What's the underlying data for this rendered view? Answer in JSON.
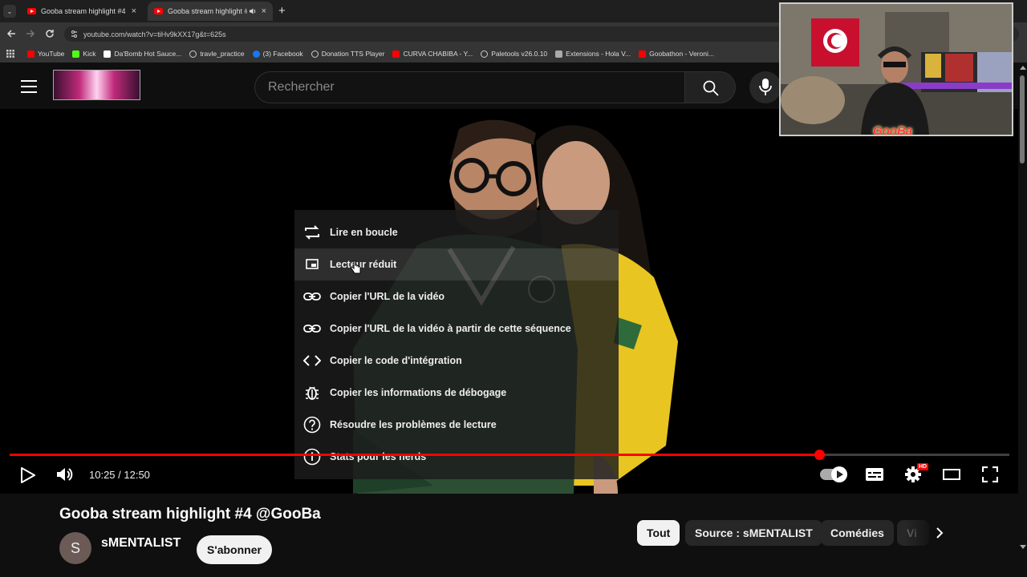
{
  "browser": {
    "tabs": [
      {
        "label": "Gooba stream highlight #4 @G",
        "close": "×"
      },
      {
        "label": "Gooba stream highlight #4",
        "close": "×"
      }
    ],
    "new_tab": "+",
    "url": "youtube.com/watch?v=tiHv9kXX17g&t=625s",
    "bookmarks": [
      {
        "label": "YouTube",
        "color": "#ff0000"
      },
      {
        "label": "Kick",
        "color": "#53fc18"
      },
      {
        "label": "Da'Bomb Hot Sauce...",
        "color": "#ffffff"
      },
      {
        "label": "travle_practice",
        "color": "#cccccc"
      },
      {
        "label": "(3) Facebook",
        "color": "#1877f2"
      },
      {
        "label": "Donation TTS Player",
        "color": "#cccccc"
      },
      {
        "label": "CURVA CHABIBA - Y...",
        "color": "#ff0000"
      },
      {
        "label": "Paletools v26.0.10",
        "color": "#cccccc"
      },
      {
        "label": "Extensions - Hola V...",
        "color": "#cccccc"
      },
      {
        "label": "Goobathon - Veroni...",
        "color": "#ff0000"
      }
    ]
  },
  "youtube": {
    "search_placeholder": "Rechercher"
  },
  "player": {
    "time": "10:25 / 12:50",
    "progress": 0.81,
    "hd_badge": "HD"
  },
  "context_menu": {
    "items": [
      {
        "label": "Lire en boucle",
        "icon": "loop-icon"
      },
      {
        "label": "Lecteur réduit",
        "icon": "miniplayer-icon",
        "hovered": true
      },
      {
        "label": "Copier l'URL de la vidéo",
        "icon": "link-icon"
      },
      {
        "label": "Copier l'URL de la vidéo à partir de cette séquence",
        "icon": "link-icon"
      },
      {
        "label": "Copier le code d'intégration",
        "icon": "embed-code-icon"
      },
      {
        "label": "Copier les informations de débogage",
        "icon": "debug-icon"
      },
      {
        "label": "Résoudre les problèmes de lecture",
        "icon": "help-icon"
      },
      {
        "label": "Stats pour les nerds",
        "icon": "info-icon"
      }
    ]
  },
  "video_info": {
    "title": "Gooba stream highlight #4 @GooBa",
    "channel": "sMENTALIST",
    "avatar_letter": "S",
    "subscribe": "S'abonner"
  },
  "chips": [
    {
      "label": "Tout",
      "selected": true
    },
    {
      "label": "Source : sMENTALIST"
    },
    {
      "label": "Comédies"
    },
    {
      "label": "Vi"
    }
  ],
  "webcam": {
    "logo_text": "GooBa"
  }
}
